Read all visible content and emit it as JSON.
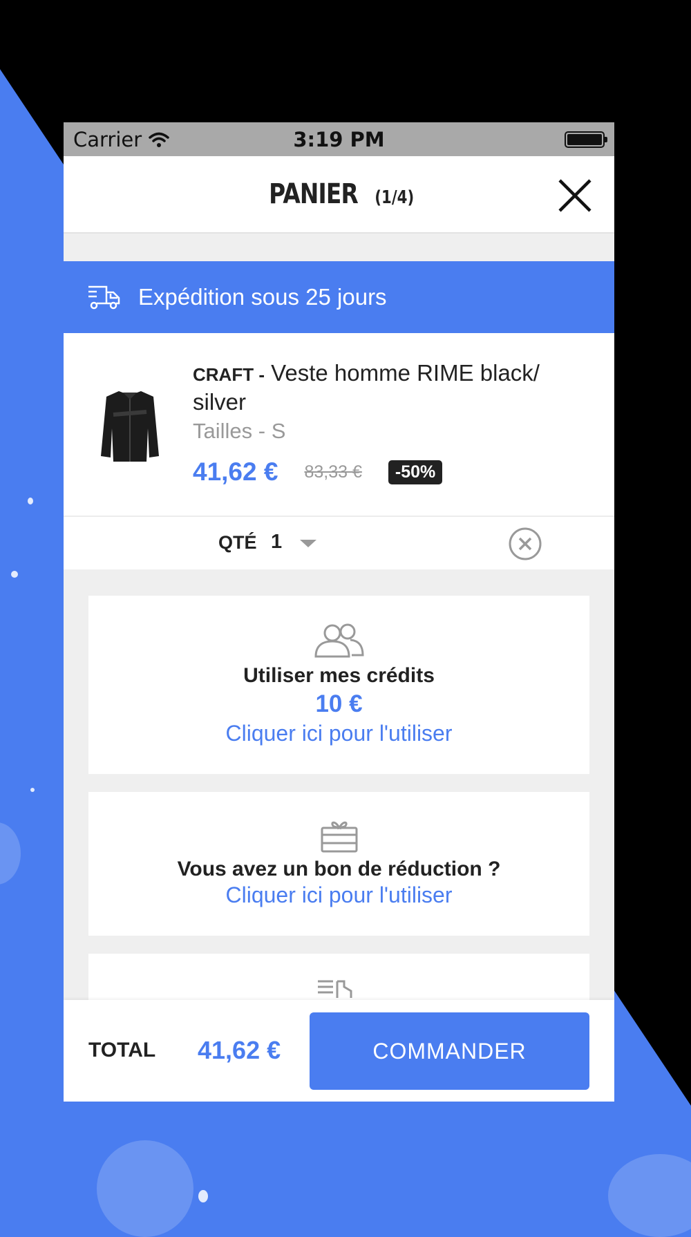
{
  "status_bar": {
    "carrier": "Carrier",
    "time": "3:19 PM"
  },
  "header": {
    "title": "PANIER",
    "count": "(1/4)",
    "close_icon": "close-icon"
  },
  "shipping_banner": {
    "icon": "truck-icon",
    "text": "Expédition sous 25 jours"
  },
  "product": {
    "brand": "CRAFT -",
    "name": "Veste homme RIME black/ silver",
    "size": "Tailles - S",
    "price": "41,62 €",
    "old_price": "83,33 €",
    "discount": "-50%",
    "image_icon": "jacket-image"
  },
  "quantity": {
    "label": "QTÉ",
    "value": "1",
    "remove_icon": "remove-circle-icon"
  },
  "credits_card": {
    "icon": "users-icon",
    "title": "Utiliser mes crédits",
    "amount": "10 €",
    "link": "Cliquer ici pour l'utiliser"
  },
  "voucher_card": {
    "icon": "gift-card-icon",
    "title": "Vous avez un bon de réduction ?",
    "link": "Cliquer ici pour l'utiliser"
  },
  "footer": {
    "total_label": "TOTAL",
    "total_value": "41,62 €",
    "order_button": "COMMANDER"
  },
  "colors": {
    "accent": "#4a7df0",
    "background_dark": "#000000",
    "discount_badge": "#222222"
  }
}
